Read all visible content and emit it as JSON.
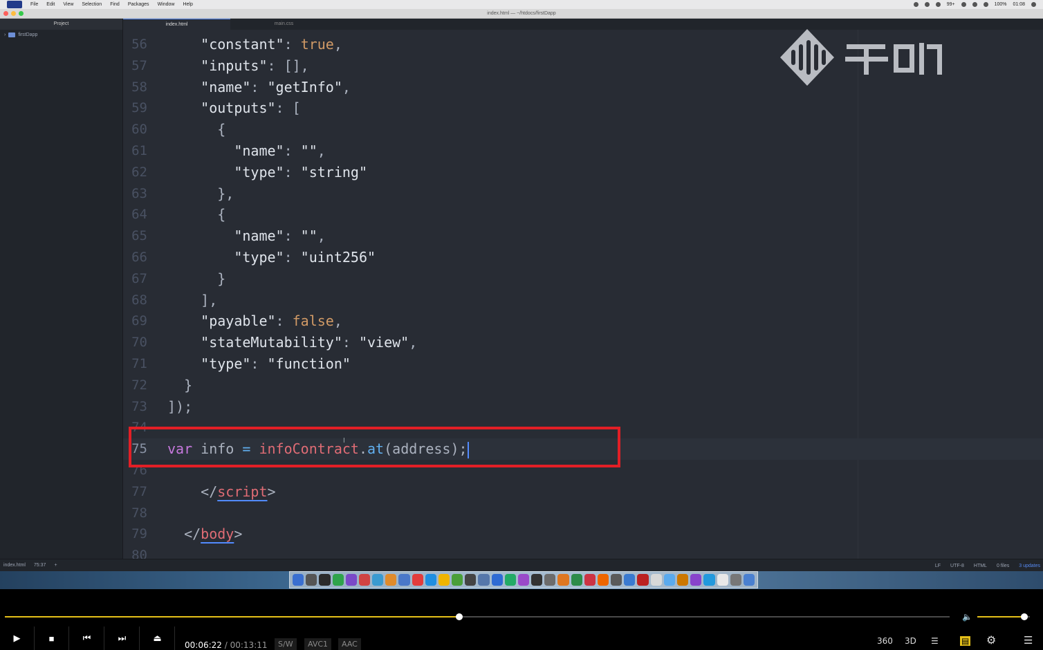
{
  "menubar": {
    "items": [
      "File",
      "Edit",
      "View",
      "Selection",
      "Find",
      "Packages",
      "Window",
      "Help"
    ],
    "right_items": [
      "99+",
      "100%",
      "01:08"
    ]
  },
  "window": {
    "title": "index.html — ~/htdocs/firstDapp"
  },
  "tree": {
    "header": "Project",
    "root": "firstDapp"
  },
  "tabs": [
    {
      "label": "index.html",
      "active": true
    },
    {
      "label": "main.css",
      "active": false
    }
  ],
  "editor": {
    "lines": [
      {
        "n": "56",
        "tokens": [
          [
            "    ",
            ""
          ],
          [
            "\"constant\"",
            "key"
          ],
          [
            ": ",
            "pun"
          ],
          [
            "true",
            "bool"
          ],
          [
            ",",
            "pun"
          ]
        ]
      },
      {
        "n": "57",
        "tokens": [
          [
            "    ",
            ""
          ],
          [
            "\"inputs\"",
            "key"
          ],
          [
            ": [],",
            "pun"
          ]
        ]
      },
      {
        "n": "58",
        "tokens": [
          [
            "    ",
            ""
          ],
          [
            "\"name\"",
            "key"
          ],
          [
            ": ",
            "pun"
          ],
          [
            "\"getInfo\"",
            "key"
          ],
          [
            ",",
            "pun"
          ]
        ]
      },
      {
        "n": "59",
        "tokens": [
          [
            "    ",
            ""
          ],
          [
            "\"outputs\"",
            "key"
          ],
          [
            ": [",
            "pun"
          ]
        ]
      },
      {
        "n": "60",
        "tokens": [
          [
            "      {",
            "pun"
          ]
        ]
      },
      {
        "n": "61",
        "tokens": [
          [
            "        ",
            ""
          ],
          [
            "\"name\"",
            "key"
          ],
          [
            ": ",
            "pun"
          ],
          [
            "\"\"",
            "key"
          ],
          [
            ",",
            "pun"
          ]
        ]
      },
      {
        "n": "62",
        "tokens": [
          [
            "        ",
            ""
          ],
          [
            "\"type\"",
            "key"
          ],
          [
            ": ",
            "pun"
          ],
          [
            "\"string\"",
            "key"
          ]
        ]
      },
      {
        "n": "63",
        "tokens": [
          [
            "      },",
            "pun"
          ]
        ]
      },
      {
        "n": "64",
        "tokens": [
          [
            "      {",
            "pun"
          ]
        ]
      },
      {
        "n": "65",
        "tokens": [
          [
            "        ",
            ""
          ],
          [
            "\"name\"",
            "key"
          ],
          [
            ": ",
            "pun"
          ],
          [
            "\"\"",
            "key"
          ],
          [
            ",",
            "pun"
          ]
        ]
      },
      {
        "n": "66",
        "tokens": [
          [
            "        ",
            ""
          ],
          [
            "\"type\"",
            "key"
          ],
          [
            ": ",
            "pun"
          ],
          [
            "\"uint256\"",
            "key"
          ]
        ]
      },
      {
        "n": "67",
        "tokens": [
          [
            "      }",
            "pun"
          ]
        ]
      },
      {
        "n": "68",
        "tokens": [
          [
            "    ],",
            "pun"
          ]
        ]
      },
      {
        "n": "69",
        "tokens": [
          [
            "    ",
            ""
          ],
          [
            "\"payable\"",
            "key"
          ],
          [
            ": ",
            "pun"
          ],
          [
            "false",
            "bool"
          ],
          [
            ",",
            "pun"
          ]
        ]
      },
      {
        "n": "70",
        "tokens": [
          [
            "    ",
            ""
          ],
          [
            "\"stateMutability\"",
            "key"
          ],
          [
            ": ",
            "pun"
          ],
          [
            "\"view\"",
            "key"
          ],
          [
            ",",
            "pun"
          ]
        ]
      },
      {
        "n": "71",
        "tokens": [
          [
            "    ",
            ""
          ],
          [
            "\"type\"",
            "key"
          ],
          [
            ": ",
            "pun"
          ],
          [
            "\"function\"",
            "key"
          ]
        ]
      },
      {
        "n": "72",
        "tokens": [
          [
            "  }",
            "pun"
          ]
        ]
      },
      {
        "n": "73",
        "tokens": [
          [
            "]);",
            "pun"
          ]
        ]
      },
      {
        "n": "74",
        "tokens": []
      },
      {
        "n": "75",
        "tokens": [
          [
            "var",
            "kw"
          ],
          [
            " info ",
            "pun"
          ],
          [
            "=",
            "fn"
          ],
          [
            " ",
            ""
          ],
          [
            "infoContract",
            "tag"
          ],
          [
            ".",
            "pun"
          ],
          [
            "at",
            "fn"
          ],
          [
            "(address);",
            "pun"
          ]
        ],
        "cursor": true
      },
      {
        "n": "76",
        "tokens": []
      },
      {
        "n": "77",
        "tokens": [
          [
            "    </",
            "pun"
          ],
          [
            "script",
            "tag"
          ],
          [
            ">",
            "pun"
          ]
        ]
      },
      {
        "n": "78",
        "tokens": []
      },
      {
        "n": "79",
        "tokens": [
          [
            "  </",
            "pun"
          ],
          [
            "body",
            "tag"
          ],
          [
            ">",
            "pun"
          ]
        ]
      },
      {
        "n": "80",
        "tokens": []
      }
    ]
  },
  "statusbar": {
    "file": "index.html",
    "position": "75:37",
    "line_ending": "LF",
    "encoding": "UTF-8",
    "grammar": "HTML",
    "files": "0 files",
    "updates": "3 updates"
  },
  "player": {
    "current_time": "00:06:22",
    "separator": "/",
    "duration": "00:13:11",
    "progress": 0.4813,
    "volume": 0.9,
    "tags": [
      "S/W",
      "AVC1",
      "AAC"
    ],
    "right_buttons": [
      "360",
      "3D"
    ],
    "accent_color": "#e5c019"
  },
  "colors": {
    "highlight_box": "#e21f26",
    "editor_bg": "#282c34"
  }
}
